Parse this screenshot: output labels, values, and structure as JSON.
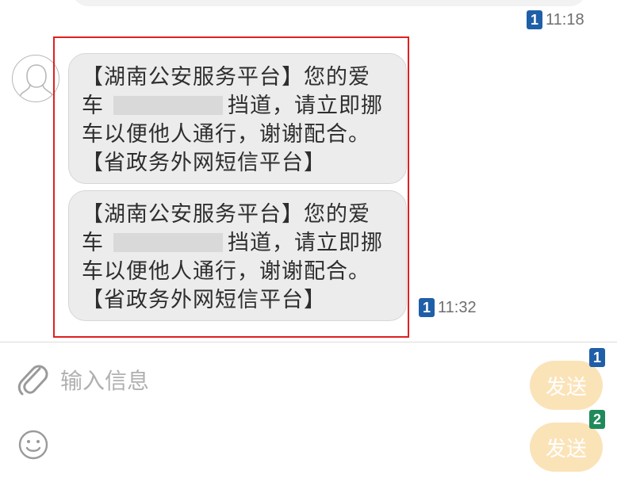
{
  "header_message": {
    "sim": "1",
    "time": "11:18"
  },
  "messages": [
    {
      "lines": [
        "【湖南公安服务平台】您的爱",
        "挡道，请立即挪",
        "车以便他人通行，谢谢配合。",
        "【省政务外网短信平台】"
      ],
      "line2_prefix": "车"
    },
    {
      "lines": [
        "【湖南公安服务平台】您的爱",
        "挡道，请立即挪",
        "车以便他人通行，谢谢配合。",
        "【省政务外网短信平台】"
      ],
      "line2_prefix": "车",
      "sim": "1",
      "time": "11:32"
    }
  ],
  "composer": {
    "placeholder": "输入信息",
    "send1_label": "发送",
    "send1_sim": "1",
    "send2_label": "发送",
    "send2_sim": "2"
  },
  "icons": {
    "attach": "paperclip-icon",
    "emoji": "smiley-icon",
    "avatar": "person-avatar-icon"
  },
  "colors": {
    "highlight_border": "#e02020",
    "bubble_bg": "#ececec",
    "send_button_bg": "#fbe3b8",
    "sim1_badge": "#1f5fa8",
    "sim2_badge": "#1f8a5a"
  }
}
